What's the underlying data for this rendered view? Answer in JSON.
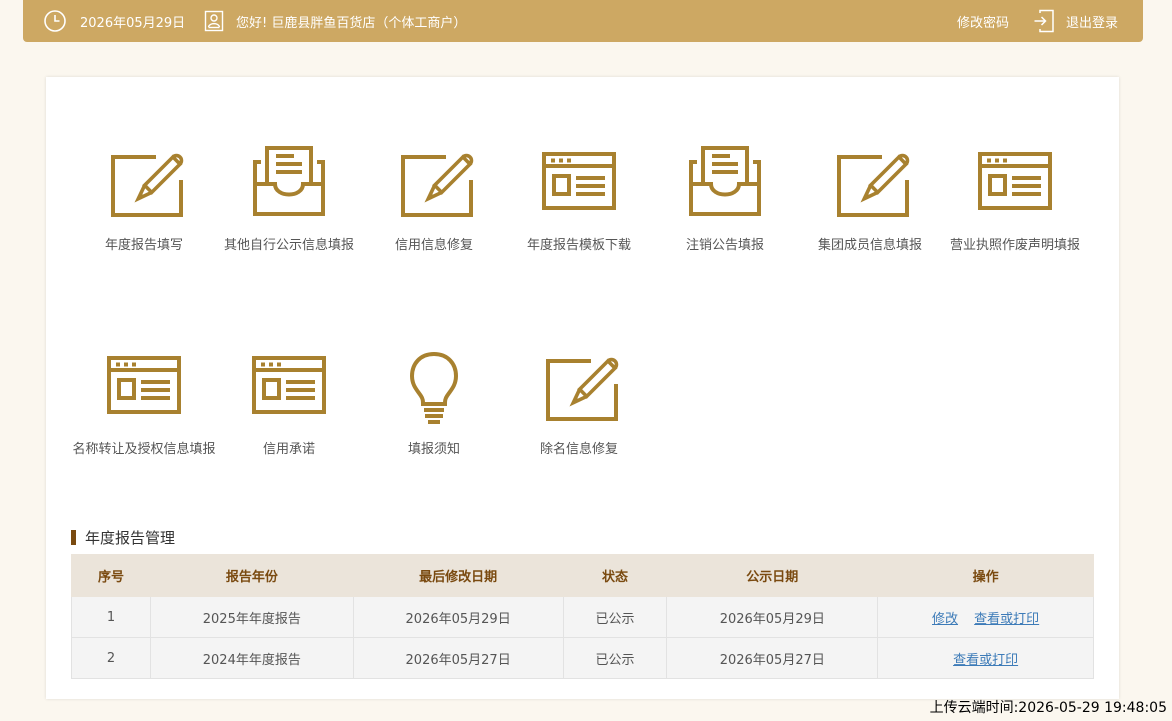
{
  "header": {
    "date": "2026年05月29日",
    "greeting": "您好! 巨鹿县胖鱼百货店（个体工商户）",
    "change_password": "修改密码",
    "logout": "退出登录"
  },
  "colors": {
    "header_bg": "#cda863",
    "icon_gold": "#a8812f",
    "section_accent": "#7a4a10",
    "link": "#3d7bb8"
  },
  "tiles": [
    {
      "label": "年度报告填写",
      "icon": "edit-pencil-icon"
    },
    {
      "label": "其他自行公示信息填报",
      "icon": "inbox-tray-icon"
    },
    {
      "label": "信用信息修复",
      "icon": "edit-pencil-icon"
    },
    {
      "label": "年度报告模板下载",
      "icon": "browser-window-icon"
    },
    {
      "label": "注销公告填报",
      "icon": "inbox-tray-icon"
    },
    {
      "label": "集团成员信息填报",
      "icon": "edit-pencil-icon"
    },
    {
      "label": "营业执照作废声明填报",
      "icon": "browser-window-icon"
    },
    {
      "label": "名称转让及授权信息填报",
      "icon": "browser-window-icon"
    },
    {
      "label": "信用承诺",
      "icon": "browser-window-icon"
    },
    {
      "label": "填报须知",
      "icon": "lightbulb-icon"
    },
    {
      "label": "除名信息修复",
      "icon": "edit-pencil-icon"
    }
  ],
  "annual_report": {
    "section_title": "年度报告管理",
    "columns": [
      "序号",
      "报告年份",
      "最后修改日期",
      "状态",
      "公示日期",
      "操作"
    ],
    "rows": [
      {
        "index": "1",
        "year": "2025年年度报告",
        "modified": "2026年05月29日",
        "status": "已公示",
        "publish": "2026年05月29日",
        "actions": [
          "修改",
          "查看或打印"
        ]
      },
      {
        "index": "2",
        "year": "2024年年度报告",
        "modified": "2026年05月27日",
        "status": "已公示",
        "publish": "2026年05月27日",
        "actions": [
          "查看或打印"
        ]
      }
    ]
  },
  "footer": {
    "upload_time": "上传云端时间:2026-05-29 19:48:05"
  }
}
